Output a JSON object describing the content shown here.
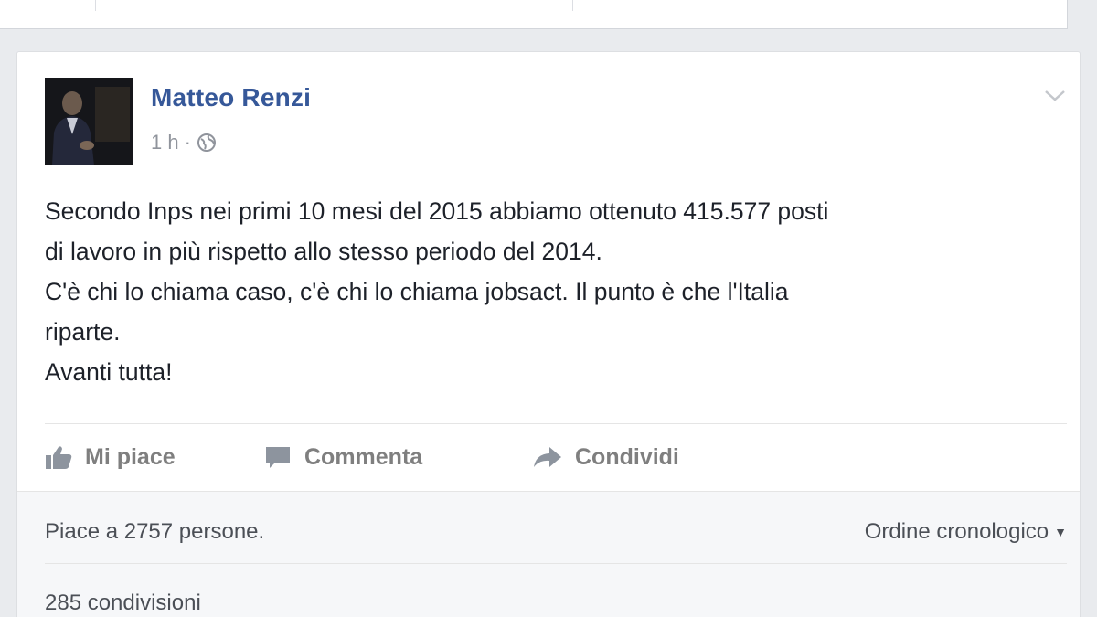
{
  "post": {
    "author": "Matteo Renzi",
    "time": "1 h",
    "meta_separator": "·",
    "privacy_icon": "globe-icon",
    "text_lines": [
      "Secondo Inps nei primi 10 mesi del 2015 abbiamo ottenuto 415.577 posti",
      "di lavoro in più rispetto allo stesso periodo del 2014.",
      "C'è chi lo chiama caso, c'è chi lo chiama jobsact. Il punto è che l'Italia",
      "riparte.",
      "Avanti tutta!"
    ]
  },
  "actions": {
    "like": "Mi piace",
    "comment": "Commenta",
    "share": "Condividi"
  },
  "footer": {
    "likes_prefix": "Piace a ",
    "likes_count": "2757",
    "likes_suffix": " persone.",
    "order": "Ordine cronologico",
    "shares": "285 condivisioni"
  },
  "colors": {
    "author_link": "#365899",
    "background": "#e9ebee",
    "action_text": "#7f7f7f"
  }
}
